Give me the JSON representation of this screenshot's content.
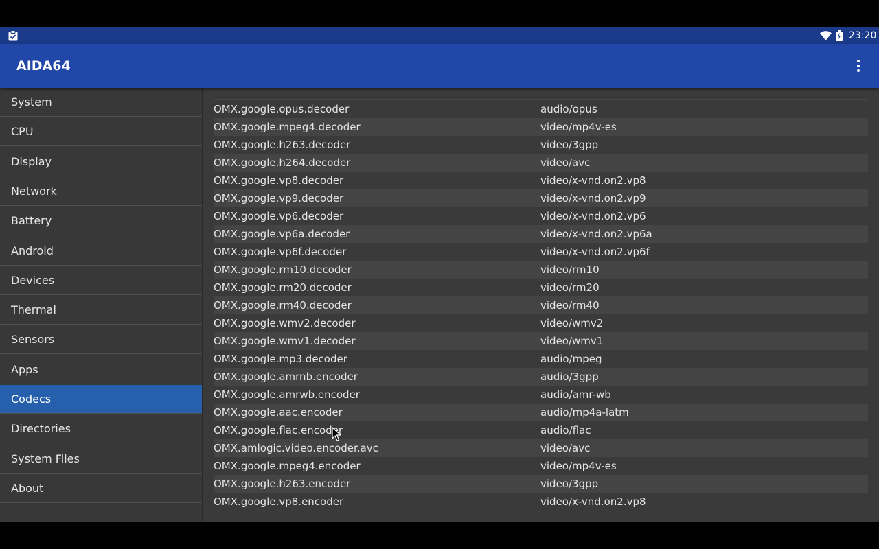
{
  "status_bar": {
    "time": "23:20",
    "notification_icon": "clipboard-check-icon",
    "wifi_icon": "wifi-icon",
    "battery_icon": "battery-charging-icon"
  },
  "app_bar": {
    "title": "AIDA64",
    "overflow_icon": "more-vert-icon"
  },
  "colors": {
    "status_bar": "#1b3a8a",
    "app_bar": "#2148a9",
    "active_nav": "#2660ad",
    "sidebar_bg": "#383838",
    "content_bg": "#3a3a3a"
  },
  "sidebar": {
    "items": [
      {
        "label": "System"
      },
      {
        "label": "CPU"
      },
      {
        "label": "Display"
      },
      {
        "label": "Network"
      },
      {
        "label": "Battery"
      },
      {
        "label": "Android"
      },
      {
        "label": "Devices"
      },
      {
        "label": "Thermal"
      },
      {
        "label": "Sensors"
      },
      {
        "label": "Apps"
      },
      {
        "label": "Codecs",
        "active": true
      },
      {
        "label": "Directories"
      },
      {
        "label": "System Files"
      },
      {
        "label": "About"
      }
    ]
  },
  "codecs": {
    "rows": [
      {
        "name": "OMX.google.opus.decoder",
        "mime": "audio/opus"
      },
      {
        "name": "OMX.google.mpeg4.decoder",
        "mime": "video/mp4v-es"
      },
      {
        "name": "OMX.google.h263.decoder",
        "mime": "video/3gpp"
      },
      {
        "name": "OMX.google.h264.decoder",
        "mime": "video/avc"
      },
      {
        "name": "OMX.google.vp8.decoder",
        "mime": "video/x-vnd.on2.vp8"
      },
      {
        "name": "OMX.google.vp9.decoder",
        "mime": "video/x-vnd.on2.vp9"
      },
      {
        "name": "OMX.google.vp6.decoder",
        "mime": "video/x-vnd.on2.vp6"
      },
      {
        "name": "OMX.google.vp6a.decoder",
        "mime": "video/x-vnd.on2.vp6a"
      },
      {
        "name": "OMX.google.vp6f.decoder",
        "mime": "video/x-vnd.on2.vp6f"
      },
      {
        "name": "OMX.google.rm10.decoder",
        "mime": "video/rm10"
      },
      {
        "name": "OMX.google.rm20.decoder",
        "mime": "video/rm20"
      },
      {
        "name": "OMX.google.rm40.decoder",
        "mime": "video/rm40"
      },
      {
        "name": "OMX.google.wmv2.decoder",
        "mime": "video/wmv2"
      },
      {
        "name": "OMX.google.wmv1.decoder",
        "mime": "video/wmv1"
      },
      {
        "name": "OMX.google.mp3.decoder",
        "mime": "audio/mpeg"
      },
      {
        "name": "OMX.google.amrnb.encoder",
        "mime": "audio/3gpp"
      },
      {
        "name": "OMX.google.amrwb.encoder",
        "mime": "audio/amr-wb"
      },
      {
        "name": "OMX.google.aac.encoder",
        "mime": "audio/mp4a-latm"
      },
      {
        "name": "OMX.google.flac.encoder",
        "mime": "audio/flac"
      },
      {
        "name": "OMX.amlogic.video.encoder.avc",
        "mime": "video/avc"
      },
      {
        "name": "OMX.google.mpeg4.encoder",
        "mime": "video/mp4v-es"
      },
      {
        "name": "OMX.google.h263.encoder",
        "mime": "video/3gpp"
      },
      {
        "name": "OMX.google.vp8.encoder",
        "mime": "video/x-vnd.on2.vp8"
      }
    ]
  }
}
